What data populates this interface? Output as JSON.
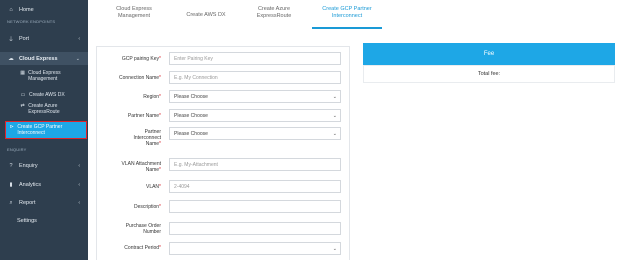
{
  "sidebar": {
    "home": "Home",
    "section_network": "NETWORK ENDPOINTS",
    "port": "Port",
    "cloud_express": "Cloud Express",
    "sub_items": [
      {
        "label": "Cloud Express Management",
        "icon": "grid-icon"
      },
      {
        "label": "Create AWS DX",
        "icon": "box-icon"
      },
      {
        "label": "Create Azure ExpressRoute",
        "icon": "arrows-icon"
      }
    ],
    "selected_item": "Create GCP Partner Interconnect",
    "section_enquiry": "ENQUIRY",
    "enquiry": "Enquiry",
    "analytics": "Analytics",
    "report": "Report",
    "settings": "Settings"
  },
  "tabs": [
    {
      "label": "Cloud Express Management",
      "active": false
    },
    {
      "label": "Create AWS DX",
      "active": false
    },
    {
      "label": "Create Azure ExpressRoute",
      "active": false
    },
    {
      "label": "Create GCP Partner Interconnect",
      "active": true
    }
  ],
  "form": {
    "fields": [
      {
        "label": "GCP pairing Key",
        "required": true,
        "placeholder": "Enter Pairing Key",
        "type": "input"
      },
      {
        "label": "Connection Name",
        "required": true,
        "placeholder": "E.g. My Connection",
        "type": "input"
      },
      {
        "label": "Region",
        "required": true,
        "value": "Please Choose",
        "type": "select"
      },
      {
        "label": "Partner Name",
        "required": true,
        "value": "Please Choose",
        "type": "select"
      },
      {
        "label": "Partner Interconnect Name",
        "required": true,
        "value": "Please Choose",
        "type": "select"
      },
      {
        "label": "VLAN Attachment Name",
        "required": true,
        "placeholder": "E.g. My-Attachment",
        "type": "input"
      },
      {
        "label": "VLAN",
        "required": true,
        "placeholder": "2-4094",
        "type": "input"
      },
      {
        "label": "Description",
        "required": true,
        "placeholder": "",
        "type": "input"
      },
      {
        "label": "Purchase Order Number",
        "required": false,
        "placeholder": "",
        "type": "input"
      },
      {
        "label": "Contract Period",
        "required": true,
        "value": "",
        "type": "select"
      }
    ],
    "required_mark": "*"
  },
  "fee": {
    "title": "Fee",
    "total_label": "Total fee:"
  },
  "colors": {
    "sidebar_bg": "#2e3e4e",
    "accent": "#1ea7e6",
    "highlight_border": "#e0232b",
    "required": "#d9252d"
  }
}
